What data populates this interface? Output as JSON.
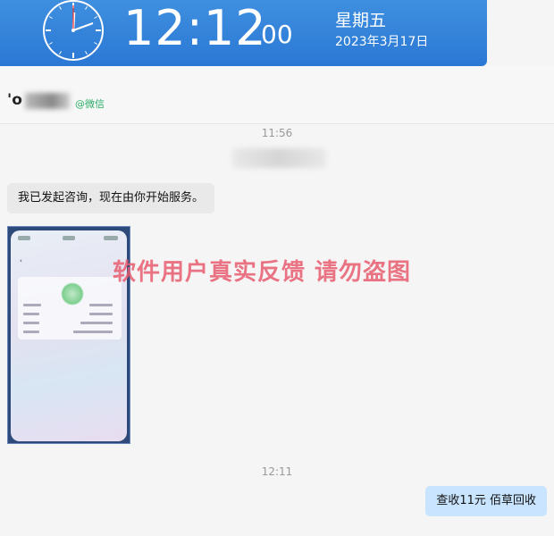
{
  "clock": {
    "time": "12:12",
    "seconds": "00",
    "weekday": "星期五",
    "date": "2023年3月17日"
  },
  "header": {
    "contact_name": "'o",
    "source_tag": "@微信"
  },
  "chat": {
    "timestamp_1": "11:56",
    "timestamp_2": "12:11",
    "msg_incoming": "我已发起咨询，现在由你开始服务。",
    "msg_outgoing": "查收11元  佰草回收"
  },
  "watermark": "软件用户真实反馈  请勿盗图",
  "colors": {
    "banner": "#2a78d4",
    "outgoing_bubble": "#c9e4ff",
    "incoming_bubble": "#e9e9e9",
    "wechat_tag": "#2aae67",
    "watermark": "#e85c6e"
  }
}
